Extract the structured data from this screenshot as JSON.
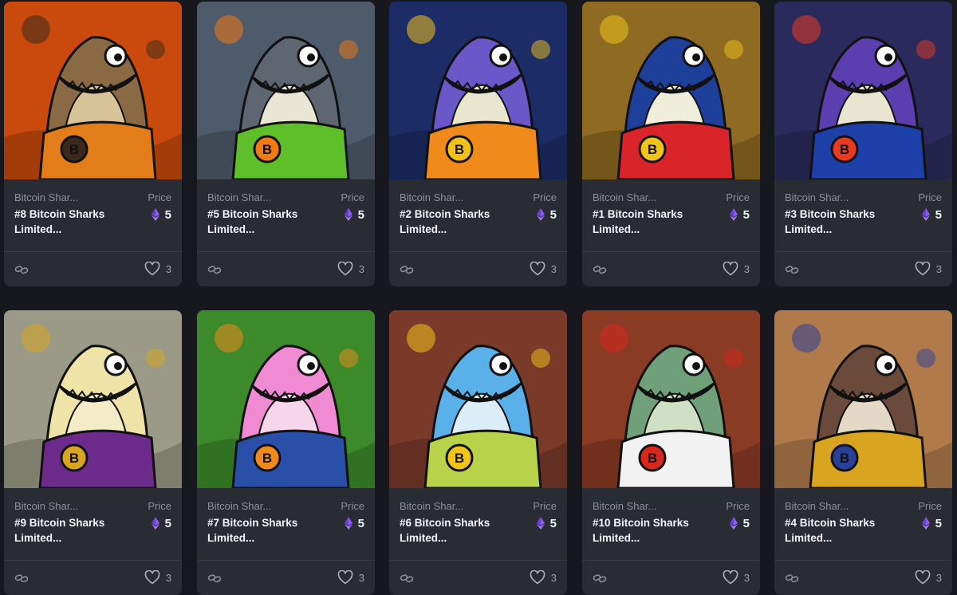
{
  "gallery": {
    "cards": [
      {
        "collection": "Bitcoin Shar...",
        "price_label": "Price",
        "title": "#8 Bitcoin Sharks Limited...",
        "price": "5",
        "likes": "3",
        "palette": {
          "bg": "#c94a0c",
          "body": "#8a6a45",
          "belly": "#d9c49a",
          "outfit": "#e27d1a",
          "accent": "#3b2a1c"
        }
      },
      {
        "collection": "Bitcoin Shar...",
        "price_label": "Price",
        "title": "#5 Bitcoin Sharks Limited...",
        "price": "5",
        "likes": "3",
        "palette": {
          "bg": "#4d5b6a",
          "body": "#5e6672",
          "belly": "#e9e6d6",
          "outfit": "#5fbf2a",
          "accent": "#f27a12"
        }
      },
      {
        "collection": "Bitcoin Shar...",
        "price_label": "Price",
        "title": "#2 Bitcoin Sharks Limited...",
        "price": "5",
        "likes": "3",
        "palette": {
          "bg": "#1c2c66",
          "body": "#6a58c8",
          "belly": "#e9e6cf",
          "outfit": "#f08a1a",
          "accent": "#f3c21a"
        }
      },
      {
        "collection": "Bitcoin Shar...",
        "price_label": "Price",
        "title": "#1 Bitcoin Sharks Limited...",
        "price": "5",
        "likes": "3",
        "palette": {
          "bg": "#8e6a22",
          "body": "#1e3f9a",
          "belly": "#eeeedb",
          "outfit": "#d9242a",
          "accent": "#f0c419"
        }
      },
      {
        "collection": "Bitcoin Shar...",
        "price_label": "Price",
        "title": "#3 Bitcoin Sharks Limited...",
        "price": "5",
        "likes": "3",
        "palette": {
          "bg": "#2a2a5c",
          "body": "#5b3fb0",
          "belly": "#e8e6d1",
          "outfit": "#1d3fa8",
          "accent": "#e83a22"
        }
      },
      {
        "collection": "Bitcoin Shar...",
        "price_label": "Price",
        "title": "#9 Bitcoin Sharks Limited...",
        "price": "5",
        "likes": "3",
        "palette": {
          "bg": "#9a9a86",
          "body": "#efe3a8",
          "belly": "#f4ecc6",
          "outfit": "#6c2a8a",
          "accent": "#d9a520"
        }
      },
      {
        "collection": "Bitcoin Shar...",
        "price_label": "Price",
        "title": "#7 Bitcoin Sharks Limited...",
        "price": "5",
        "likes": "3",
        "palette": {
          "bg": "#3c8a2a",
          "body": "#f08ad2",
          "belly": "#f7d6ea",
          "outfit": "#2a4fa8",
          "accent": "#f08a1a"
        }
      },
      {
        "collection": "Bitcoin Shar...",
        "price_label": "Price",
        "title": "#6 Bitcoin Sharks Limited...",
        "price": "5",
        "likes": "3",
        "palette": {
          "bg": "#7a3a2a",
          "body": "#5ab0e8",
          "belly": "#dbeef8",
          "outfit": "#b8d24a",
          "accent": "#f0c419"
        }
      },
      {
        "collection": "Bitcoin Shar...",
        "price_label": "Price",
        "title": "#10 Bitcoin Sharks Limited...",
        "price": "5",
        "likes": "3",
        "palette": {
          "bg": "#8a3b24",
          "body": "#6fa07a",
          "belly": "#cfe0c4",
          "outfit": "#f2f2f2",
          "accent": "#d8281e"
        }
      },
      {
        "collection": "Bitcoin Shar...",
        "price_label": "Price",
        "title": "#4 Bitcoin Sharks Limited...",
        "price": "5",
        "likes": "3",
        "palette": {
          "bg": "#b07a4a",
          "body": "#6a4a3a",
          "belly": "#e4d8c6",
          "outfit": "#d9a520",
          "accent": "#2a3f9a"
        }
      }
    ]
  },
  "icons": {
    "currency": "eth-icon",
    "link": "link-icon",
    "like": "heart-icon"
  },
  "colors": {
    "page_bg": "#16181d",
    "card_bg": "#2a2c33",
    "eth": "#8c5cf0"
  }
}
